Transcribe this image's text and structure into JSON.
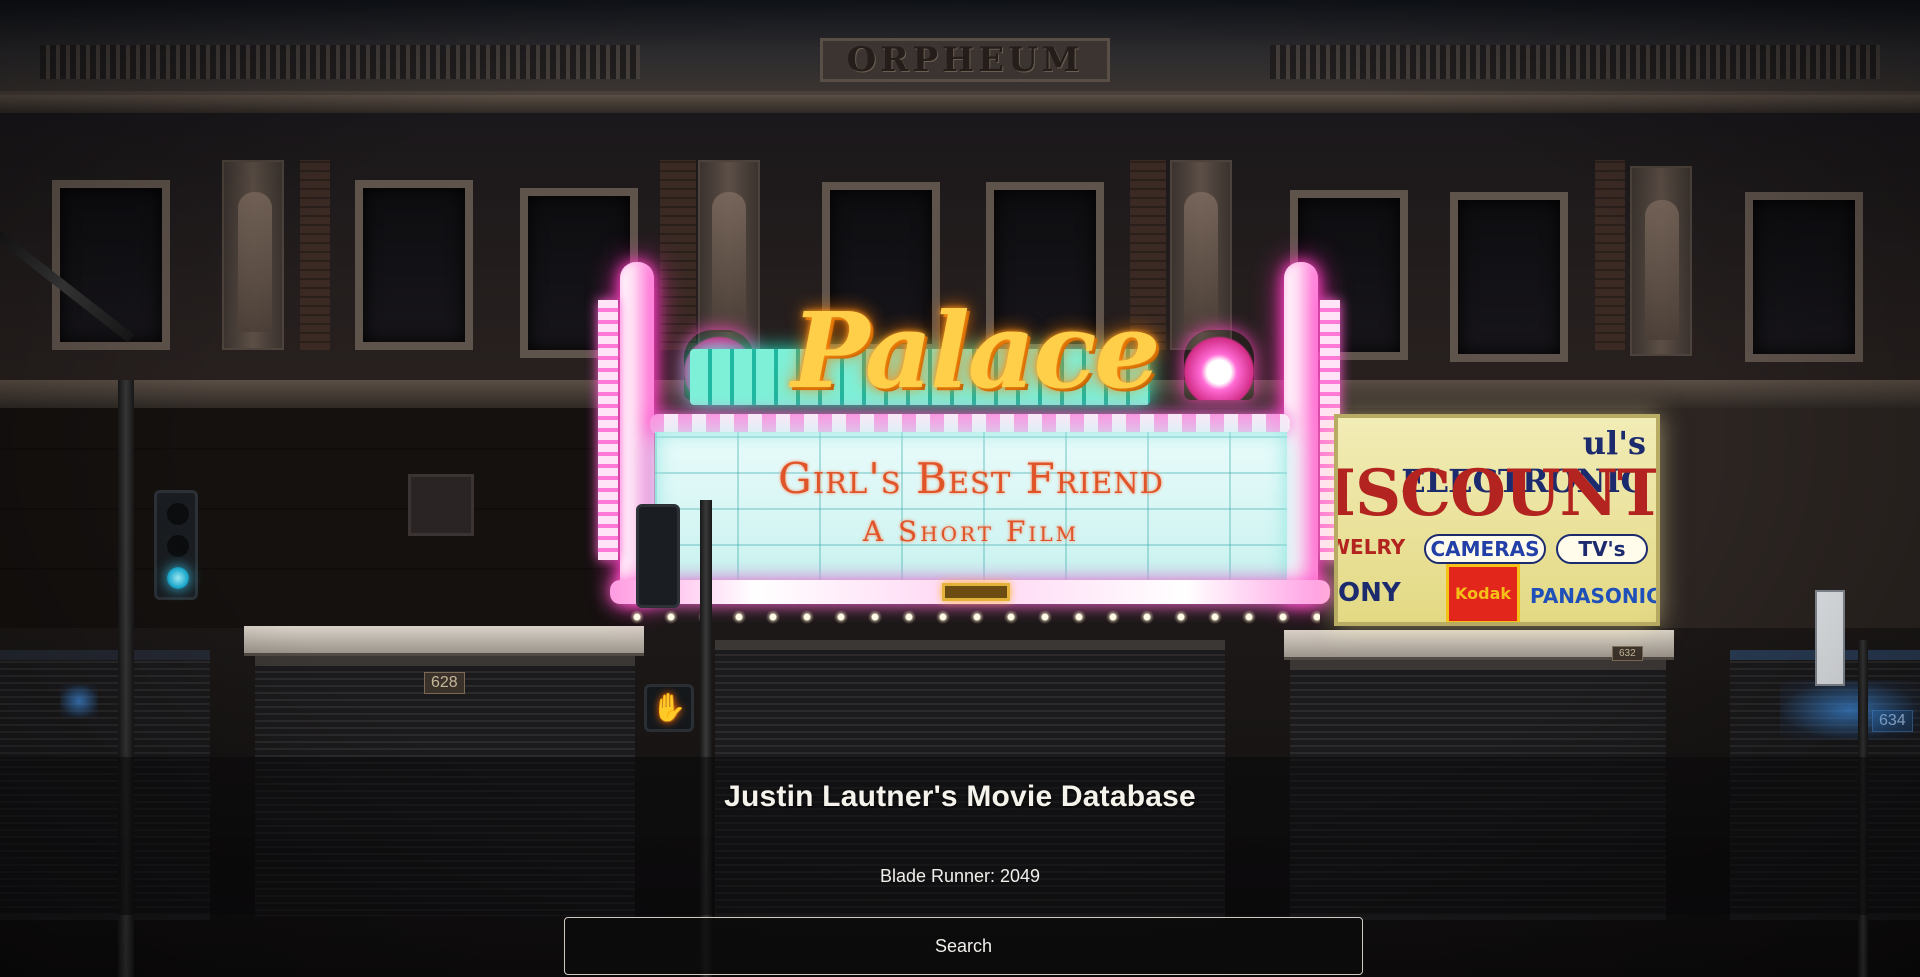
{
  "app": {
    "title": "Justin Lautner's Movie Database"
  },
  "search": {
    "value": "Blade Runner: 2049",
    "button_label": "Search"
  },
  "background": {
    "facade_inscription": "ORPHEUM",
    "marquee_sign": "Palace",
    "marquee_line_1": "Girl's Best Friend",
    "marquee_line_2": "A Short Film",
    "store_sign_top": "ul's ELECTRONIC",
    "store_sign_main": "ISCOUNT",
    "store_sign_items": [
      "WELRY",
      "CAMERAS",
      "TV's"
    ],
    "store_sign_brands": [
      "ONY",
      "Kodak",
      "PANASONIC"
    ],
    "address_left": "628",
    "address_mid": "632",
    "address_right": "634"
  },
  "colors": {
    "overlay": "#0a0a0b",
    "title_text": "#f6f3ec",
    "button_border": "#cfc9c0",
    "neon_pink": "#ff46c7",
    "neon_gold": "#ffcf4a",
    "neon_teal": "#29e6c6"
  },
  "icons": {
    "pedestrian_signal": "hand-icon"
  }
}
